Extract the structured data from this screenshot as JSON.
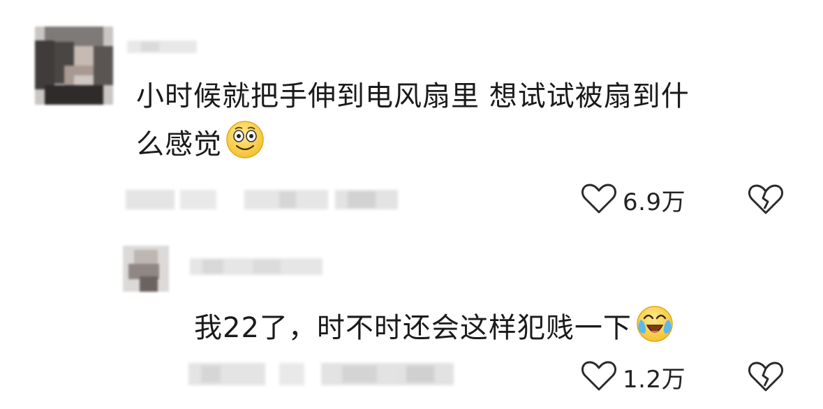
{
  "comments": [
    {
      "text": "小时候就把手伸到电风扇里 想试试被扇到什么感觉",
      "text_line1": "小时候就把手伸到电风扇里 想试试被扇到什",
      "text_line2": "么感觉",
      "emoji": "grinning-emoji",
      "likes": "6.9万"
    },
    {
      "text": "我22了，时不时还会这样犯贱一下",
      "emoji": "laughing-tears-emoji",
      "likes": "1.2万"
    }
  ],
  "icons": {
    "like": "heart-outline-icon",
    "dislike": "broken-heart-icon"
  },
  "colors": {
    "text": "#1a1a1a",
    "icon": "#2a2a2a",
    "blur": "#e2e2e2"
  }
}
